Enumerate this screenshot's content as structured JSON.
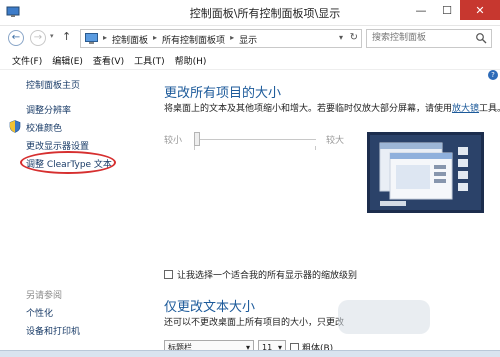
{
  "window": {
    "title": "控制面板\\所有控制面板项\\显示",
    "minimize_glyph": "—",
    "maximize_glyph": "☐",
    "close_glyph": "✕"
  },
  "address": {
    "back_glyph": "←",
    "forward_glyph": "→",
    "dropdown_glyph": "▾",
    "up_glyph": "↑",
    "crumbs": [
      "控制面板",
      "所有控制面板项",
      "显示"
    ],
    "crumb_separator": "▸",
    "refresh_glyph": "↻",
    "search_placeholder": "搜索控制面板"
  },
  "menu": [
    "文件(F)",
    "编辑(E)",
    "查看(V)",
    "工具(T)",
    "帮助(H)"
  ],
  "nav": {
    "home": "控制面板主页",
    "items": [
      "调整分辨率",
      "校准颜色",
      "更改显示器设置",
      "调整 ClearType 文本"
    ],
    "see_also_title": "另请参阅",
    "see_also": [
      "个性化",
      "设备和打印机"
    ]
  },
  "main": {
    "heading1": "更改所有项目的大小",
    "desc1_prefix": "将桌面上的文本及其他项缩小和增大。若要临时仅放大部分屏幕，请使用",
    "desc1_link": "放大镜",
    "desc1_suffix": "工具。",
    "slider_min": "较小",
    "slider_max": "较大",
    "checkbox_label": "让我选择一个适合我的所有显示器的缩放级别",
    "heading2": "仅更改文本大小",
    "desc2": "还可以不更改桌面上所有项目的大小，只更改",
    "font_target": "标题栏",
    "font_size": "11",
    "bold_label": "粗体(B)",
    "dropdown_glyph": "▾",
    "help_glyph": "?"
  },
  "colors": {
    "accent": "#1c5a9a",
    "highlight_ring": "#d62f2f",
    "close_button": "#c7372f",
    "preview_background": "#2a4168"
  }
}
